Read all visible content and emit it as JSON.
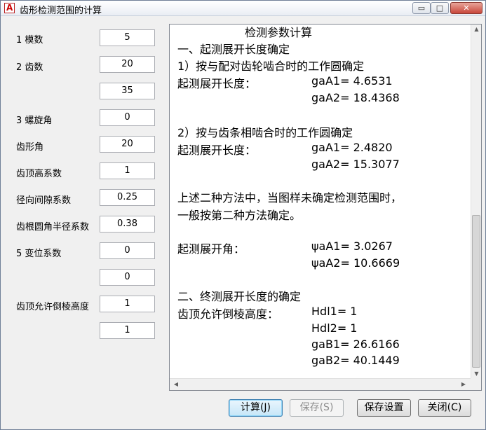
{
  "window": {
    "title": "齿形检测范围的计算",
    "app_icon_glyph": "A"
  },
  "titlebar_buttons": {
    "minimize": "▭",
    "maximize": "□",
    "close": "✕"
  },
  "params": [
    {
      "label": "1 模数",
      "value": "5"
    },
    {
      "label": "2 齿数",
      "value": "20"
    },
    {
      "label": "",
      "value": "35"
    },
    {
      "label": "3 螺旋角",
      "value": "0"
    },
    {
      "label": "齿形角",
      "value": "20"
    },
    {
      "label": "齿顶高系数",
      "value": "1"
    },
    {
      "label": "径向间隙系数",
      "value": "0.25"
    },
    {
      "label": "齿根圆角半径系数",
      "value": "0.38"
    },
    {
      "label": "5 变位系数",
      "value": "0"
    },
    {
      "label": "",
      "value": "0"
    },
    {
      "label": "齿顶允许倒棱高度",
      "value": "1"
    },
    {
      "label": "",
      "value": "1"
    }
  ],
  "results": {
    "lines": [
      "检测参数计算",
      "一、起测展开长度确定",
      "1）按与配对齿轮啮合时的工作圆确定",
      "起测展开长度：",
      "gaA1= 4.6531",
      "gaA2= 18.4368",
      "2）按与齿条相啮合时的工作圆确定",
      "起测展开长度：",
      "gaA1= 2.4820",
      "gaA2= 15.3077",
      "上述二种方法中，当图样未确定检测范围时，",
      "一般按第二种方法确定。",
      "起测展开角：",
      "ψaA1= 3.0267",
      "ψaA2= 10.6669",
      "二、终测展开长度的确定",
      "齿顶允许倒棱高度：",
      "Hdl1= 1",
      "Hdl2= 1",
      "gaB1= 26.6166",
      "gaB2= 40.1449"
    ]
  },
  "buttons": {
    "calculate": "计算(J)",
    "save": "保存(S)",
    "save_settings": "保存设置",
    "close": "关闭(C)"
  }
}
